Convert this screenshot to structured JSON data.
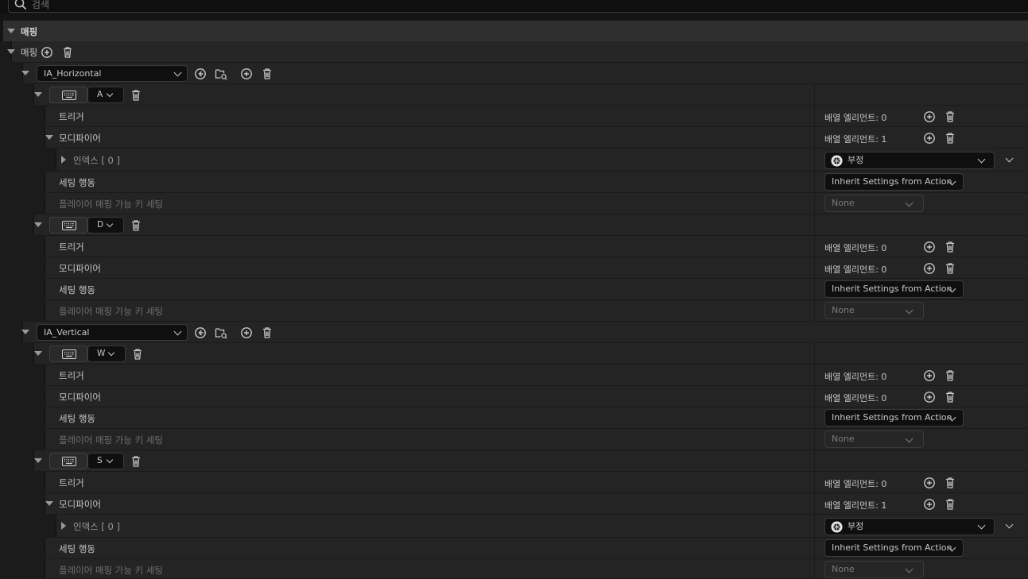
{
  "search": {
    "placeholder": "검색"
  },
  "category": {
    "label": "매핑"
  },
  "mappings_header": {
    "label": "매핑"
  },
  "actions": [
    {
      "name": "IA_Horizontal"
    },
    {
      "name": "IA_Vertical"
    }
  ],
  "keys": {
    "a": "A",
    "d": "D",
    "w": "W",
    "s": "S"
  },
  "labels": {
    "triggers": "트리거",
    "modifiers": "모디파이어",
    "index": "인덱스 [ 0 ]",
    "setting_behavior": "세팅 행동",
    "player_mappable": "플레이어 매핑 가능 키 세팅",
    "array_0": "배열 엘리먼트: 0",
    "array_1": "배열 엘리먼트: 1",
    "negate": "부정",
    "inherit": "Inherit Settings from Action",
    "none": "None"
  }
}
